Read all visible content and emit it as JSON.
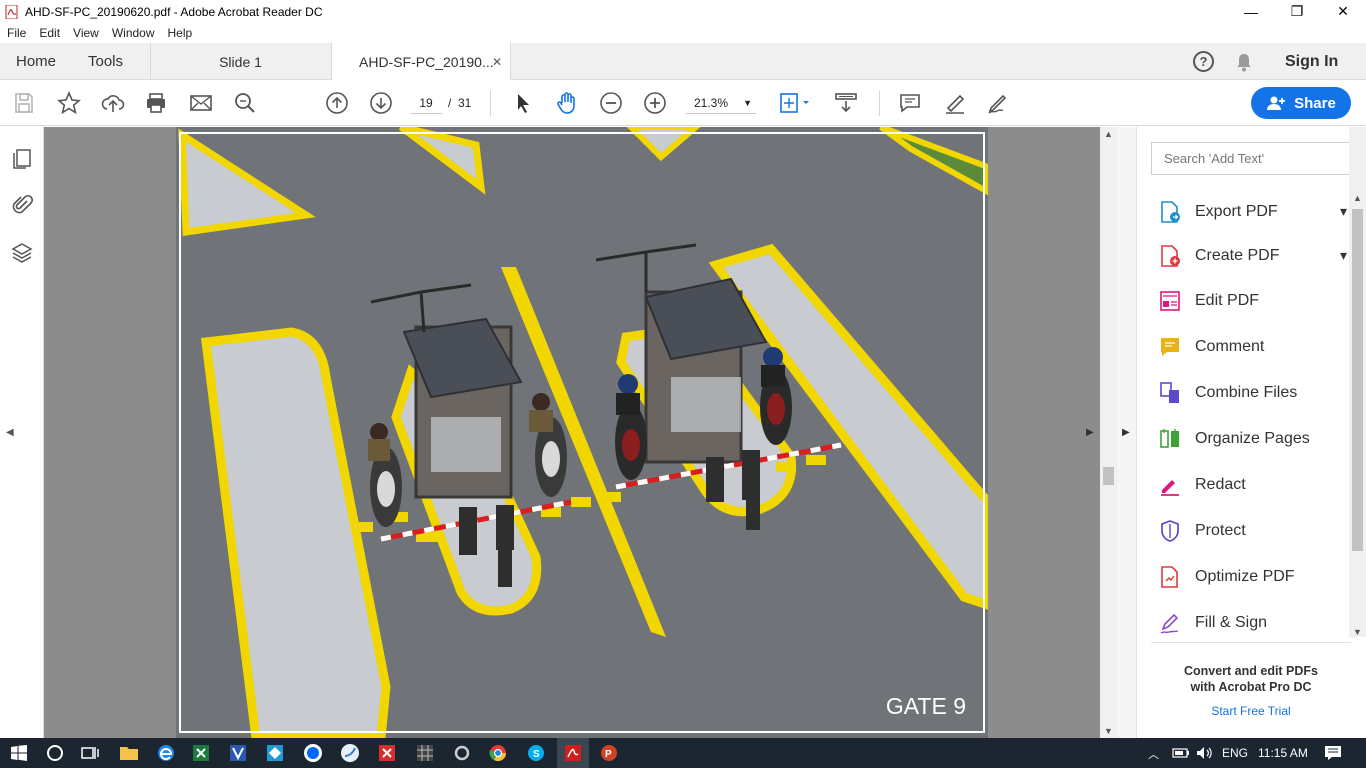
{
  "window": {
    "title": "AHD-SF-PC_20190620.pdf - Adobe Acrobat Reader DC",
    "minimize": "—",
    "maximize": "❐",
    "close": "✕"
  },
  "menu": {
    "file": "File",
    "edit": "Edit",
    "view": "View",
    "window": "Window",
    "help": "Help"
  },
  "tabs": {
    "home": "Home",
    "tools": "Tools",
    "slide": "Slide 1",
    "document": "AHD-SF-PC_20190...",
    "close": "✕",
    "help_icon": "?",
    "sign_in": "Sign In"
  },
  "toolbar": {
    "current_page": "19",
    "page_separator": "/",
    "total_pages": "31",
    "zoom": "21.3%",
    "share": "Share"
  },
  "document": {
    "page_label": "GATE 9"
  },
  "right_panel": {
    "search_placeholder": "Search 'Add Text'",
    "tools": [
      {
        "label": "Export PDF",
        "icon": "export-pdf-icon",
        "color": "#1b8fcb"
      },
      {
        "label": "Create PDF",
        "icon": "create-pdf-icon",
        "color": "#e0383e"
      },
      {
        "label": "Edit PDF",
        "icon": "edit-pdf-icon",
        "color": "#e2177b"
      },
      {
        "label": "Comment",
        "icon": "comment-icon",
        "color": "#e8b415"
      },
      {
        "label": "Combine Files",
        "icon": "combine-files-icon",
        "color": "#5b4ac9"
      },
      {
        "label": "Organize Pages",
        "icon": "organize-pages-icon",
        "color": "#3ea336"
      },
      {
        "label": "Redact",
        "icon": "redact-icon",
        "color": "#e2177b"
      },
      {
        "label": "Protect",
        "icon": "protect-icon",
        "color": "#5b4ac9"
      },
      {
        "label": "Optimize PDF",
        "icon": "optimize-pdf-icon",
        "color": "#e0383e"
      },
      {
        "label": "Fill & Sign",
        "icon": "fill-sign-icon",
        "color": "#8a4ad1"
      }
    ],
    "promo_line1": "Convert and edit PDFs",
    "promo_line2": "with Acrobat Pro DC",
    "promo_link": "Start Free Trial"
  },
  "taskbar": {
    "language": "ENG",
    "time": "11:15 AM"
  },
  "colors": {
    "accent": "#1473e6",
    "road_yellow": "#f2d600",
    "asphalt": "#707478"
  }
}
